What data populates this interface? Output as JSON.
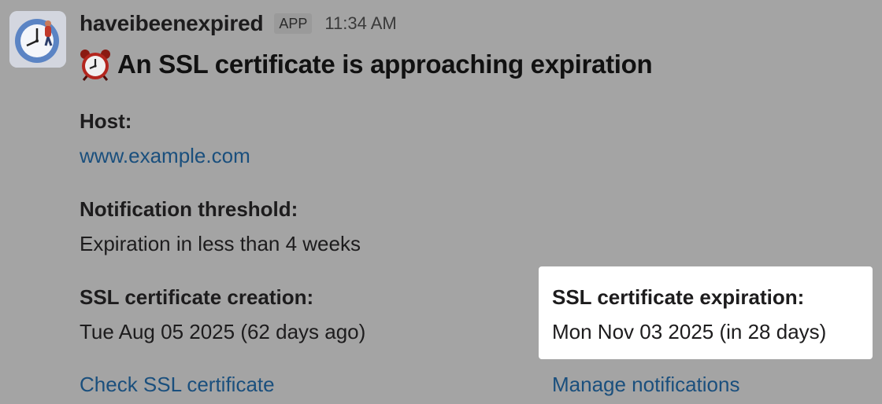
{
  "message": {
    "avatar_icon": "clock-icon",
    "app_name": "haveibeenexpired",
    "badge": "APP",
    "timestamp": "11:34 AM",
    "title_icon": "alarm-clock-icon",
    "title": "An SSL certificate is approaching expiration"
  },
  "fields": {
    "host": {
      "label": "Host:",
      "value": "www.example.com"
    },
    "threshold": {
      "label": "Notification threshold:",
      "value": "Expiration in less than 4 weeks"
    },
    "creation": {
      "label": "SSL certificate creation:",
      "value": "Tue Aug 05 2025 (62 days ago)"
    },
    "expiration": {
      "label": "SSL certificate expiration:",
      "value": "Mon Nov 03 2025 (in 28 days)"
    }
  },
  "actions": {
    "check": "Check SSL certificate",
    "manage": "Manage notifications"
  },
  "colors": {
    "overlay_background": "#a4a4a4",
    "link": "#1a4f7d",
    "highlight": "#ffffff"
  }
}
